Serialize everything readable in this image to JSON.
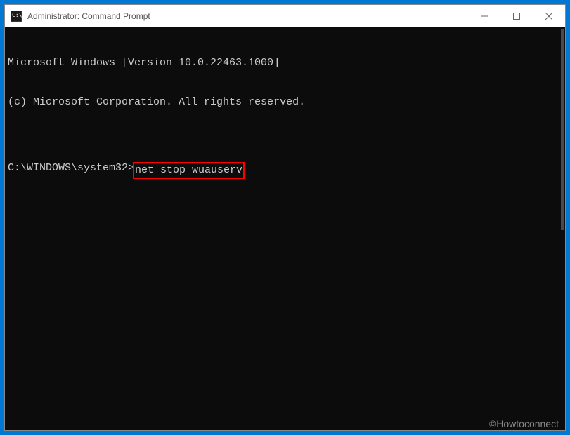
{
  "titlebar": {
    "title": "Administrator: Command Prompt"
  },
  "terminal": {
    "line1": "Microsoft Windows [Version 10.0.22463.1000]",
    "line2": "(c) Microsoft Corporation. All rights reserved.",
    "blank": "",
    "prompt": "C:\\WINDOWS\\system32>",
    "command": "net stop wuauserv"
  },
  "watermark": "©Howtoconnect"
}
